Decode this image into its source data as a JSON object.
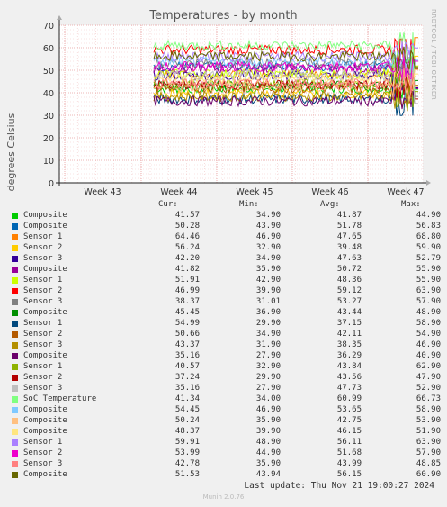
{
  "title": "Temperatures - by month",
  "side_label": "RRDTOOL / TOBI OETIKER",
  "legend_header": {
    "cur": "Cur:",
    "min": "Min:",
    "avg": "Avg:",
    "max": "Max:"
  },
  "last_update": "Last update: Thu Nov 21 19:00:27 2024",
  "footer": "Munin 2.0.76",
  "chart_data": {
    "type": "line",
    "title": "Temperatures - by month",
    "ylabel": "degrees Celsius",
    "xlabel": "",
    "ylim": [
      0,
      70
    ],
    "yticks": [
      "0",
      "10",
      "20",
      "30",
      "40",
      "50",
      "60",
      "70"
    ],
    "xticks": [
      "Week 43",
      "Week 44",
      "Week 45",
      "Week 46",
      "Week 47"
    ],
    "grid": true,
    "legend_position": "bottom",
    "series": [
      {
        "name": "Composite",
        "color": "#00cc00",
        "cur": "41.57",
        "min": "34.90",
        "avg": "41.87",
        "max": "44.90"
      },
      {
        "name": "Composite",
        "color": "#0066b3",
        "cur": "50.28",
        "min": "43.90",
        "avg": "51.78",
        "max": "56.83"
      },
      {
        "name": "Sensor 1",
        "color": "#ff8000",
        "cur": "64.46",
        "min": "46.90",
        "avg": "47.65",
        "max": "68.80"
      },
      {
        "name": "Sensor 2",
        "color": "#ffcc00",
        "cur": "56.24",
        "min": "32.90",
        "avg": "39.48",
        "max": "59.90"
      },
      {
        "name": "Sensor 3",
        "color": "#330099",
        "cur": "42.20",
        "min": "34.90",
        "avg": "47.63",
        "max": "52.79"
      },
      {
        "name": "Composite",
        "color": "#990099",
        "cur": "41.82",
        "min": "35.90",
        "avg": "50.72",
        "max": "55.90"
      },
      {
        "name": "Sensor 1",
        "color": "#ccff00",
        "cur": "51.91",
        "min": "42.90",
        "avg": "48.36",
        "max": "55.90"
      },
      {
        "name": "Sensor 2",
        "color": "#ff0000",
        "cur": "46.99",
        "min": "39.90",
        "avg": "59.12",
        "max": "63.90"
      },
      {
        "name": "Sensor 3",
        "color": "#808080",
        "cur": "38.37",
        "min": "31.01",
        "avg": "53.27",
        "max": "57.90"
      },
      {
        "name": "Composite",
        "color": "#008f00",
        "cur": "45.45",
        "min": "36.90",
        "avg": "43.44",
        "max": "48.90"
      },
      {
        "name": "Sensor 1",
        "color": "#00487d",
        "cur": "54.99",
        "min": "29.90",
        "avg": "37.15",
        "max": "58.90"
      },
      {
        "name": "Sensor 2",
        "color": "#b35a00",
        "cur": "50.66",
        "min": "34.90",
        "avg": "42.11",
        "max": "54.90"
      },
      {
        "name": "Sensor 3",
        "color": "#b38f00",
        "cur": "43.37",
        "min": "31.90",
        "avg": "38.35",
        "max": "46.90"
      },
      {
        "name": "Composite",
        "color": "#6b006b",
        "cur": "35.16",
        "min": "27.90",
        "avg": "36.29",
        "max": "40.90"
      },
      {
        "name": "Sensor 1",
        "color": "#8fb300",
        "cur": "40.57",
        "min": "32.90",
        "avg": "43.84",
        "max": "62.90"
      },
      {
        "name": "Sensor 2",
        "color": "#b30000",
        "cur": "37.24",
        "min": "29.90",
        "avg": "43.56",
        "max": "47.90"
      },
      {
        "name": "Sensor 3",
        "color": "#bebebe",
        "cur": "35.16",
        "min": "27.90",
        "avg": "47.73",
        "max": "52.90"
      },
      {
        "name": "SoC Temperature",
        "color": "#80ff80",
        "cur": "41.34",
        "min": "34.00",
        "avg": "60.99",
        "max": "66.73"
      },
      {
        "name": "Composite",
        "color": "#80c9ff",
        "cur": "54.45",
        "min": "46.90",
        "avg": "53.65",
        "max": "58.90"
      },
      {
        "name": "Composite",
        "color": "#ffc080",
        "cur": "50.24",
        "min": "35.90",
        "avg": "42.75",
        "max": "53.90"
      },
      {
        "name": "Composite",
        "color": "#ffe680",
        "cur": "48.37",
        "min": "39.90",
        "avg": "46.15",
        "max": "51.90"
      },
      {
        "name": "Sensor 1",
        "color": "#aa80ff",
        "cur": "59.91",
        "min": "48.90",
        "avg": "56.11",
        "max": "63.90"
      },
      {
        "name": "Sensor 2",
        "color": "#ee00cc",
        "cur": "53.99",
        "min": "44.90",
        "avg": "51.68",
        "max": "57.90"
      },
      {
        "name": "Sensor 3",
        "color": "#ff8080",
        "cur": "42.78",
        "min": "35.90",
        "avg": "43.99",
        "max": "48.85"
      },
      {
        "name": "Composite",
        "color": "#666600",
        "cur": "51.53",
        "min": "43.94",
        "avg": "56.15",
        "max": "60.90"
      }
    ]
  }
}
